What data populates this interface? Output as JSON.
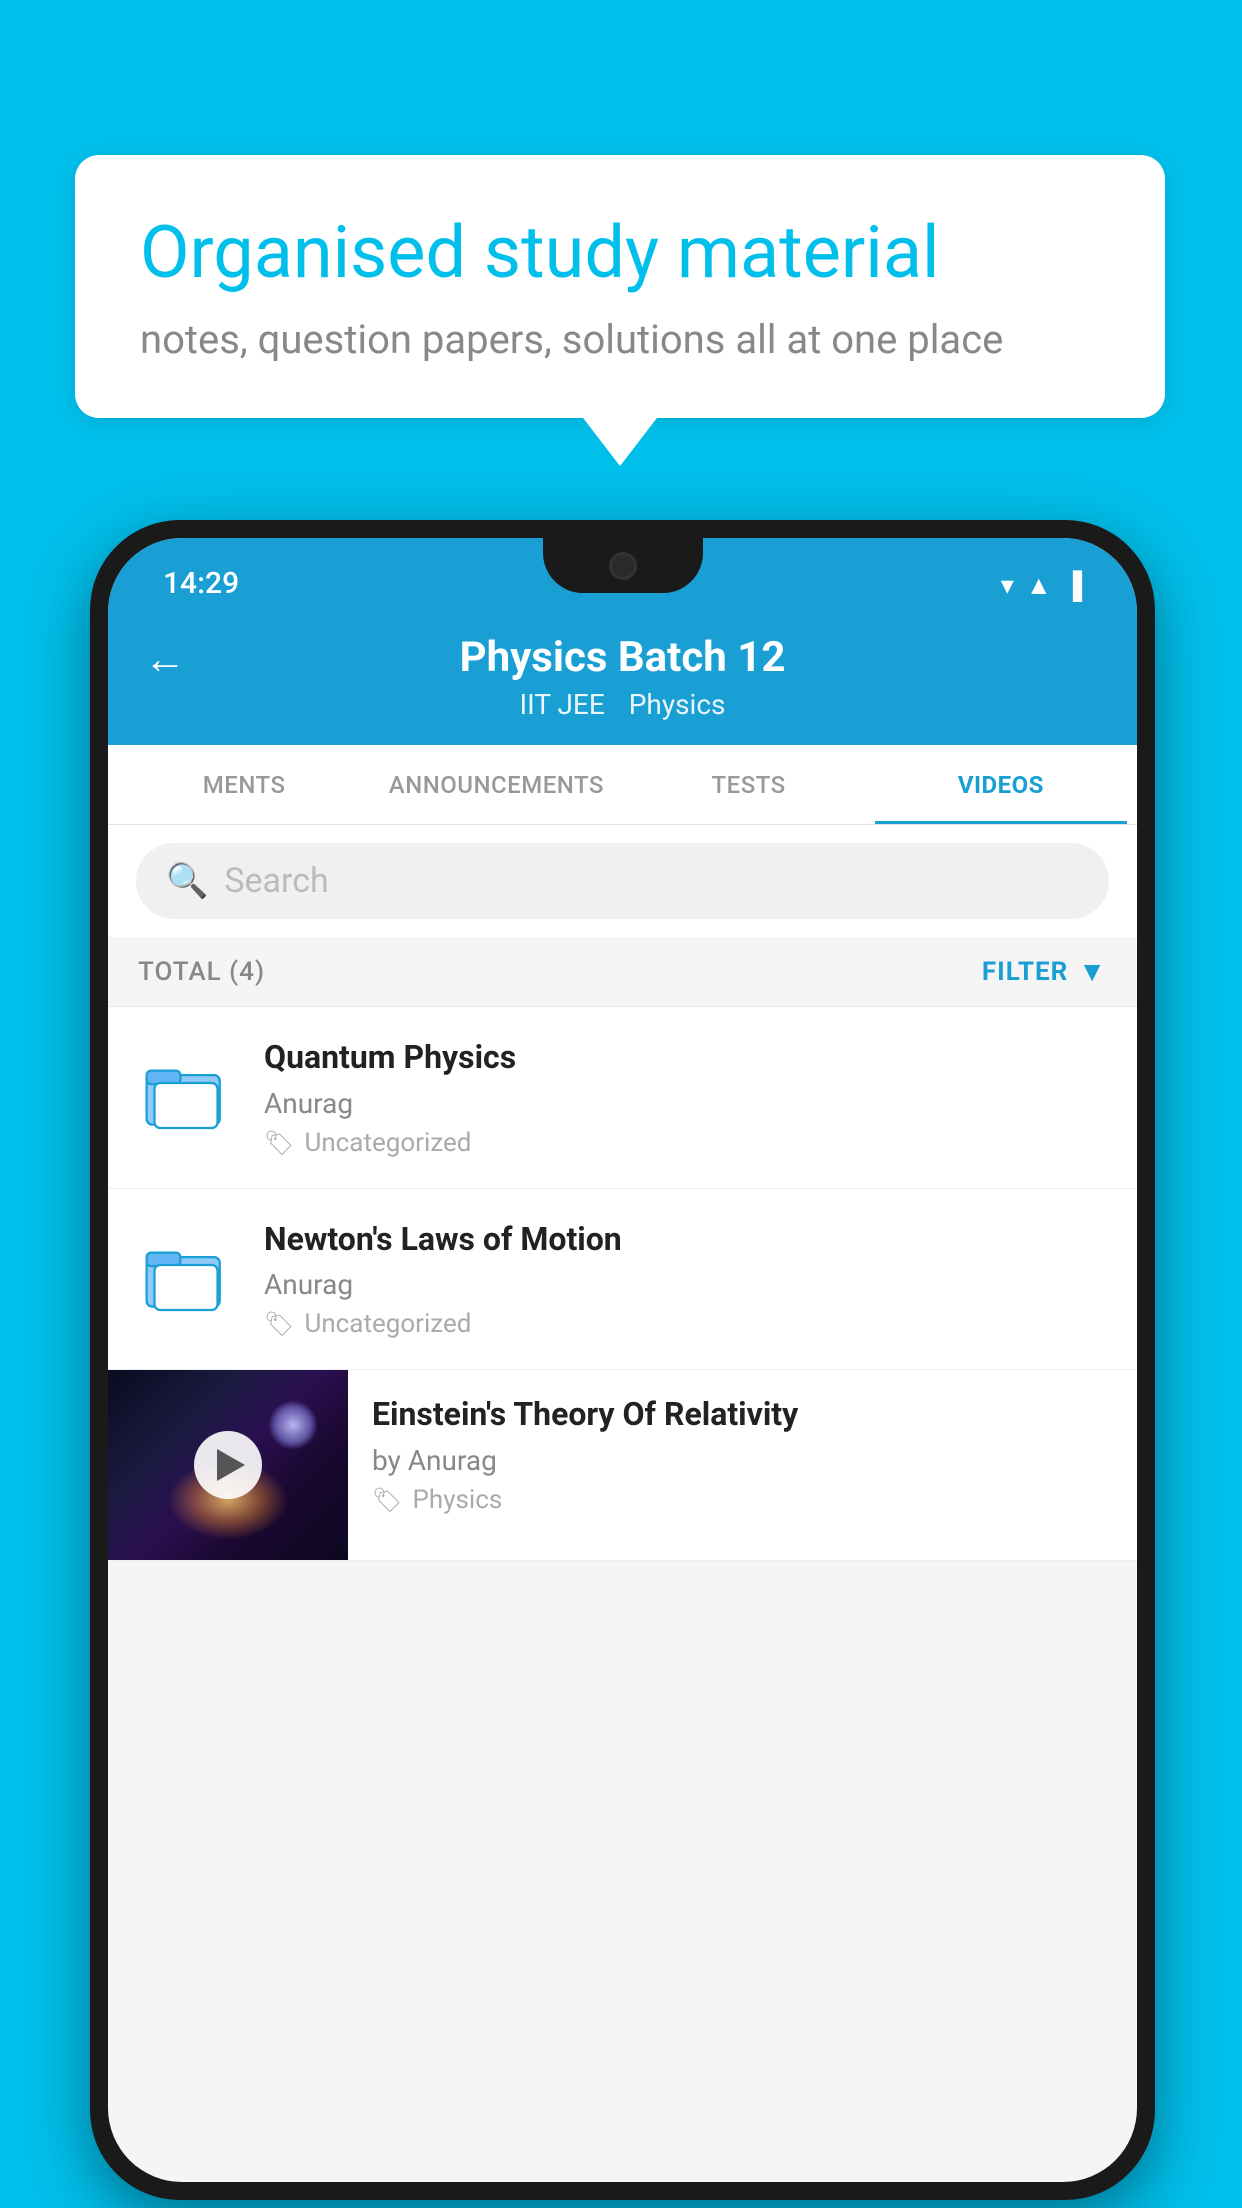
{
  "background": {
    "color": "#00BFEA"
  },
  "speech_bubble": {
    "title": "Organised study material",
    "subtitle": "notes, question papers, solutions all at one place"
  },
  "status_bar": {
    "time": "14:29",
    "icons": [
      "wifi",
      "signal",
      "battery"
    ]
  },
  "header": {
    "title": "Physics Batch 12",
    "tag1": "IIT JEE",
    "tag2": "Physics",
    "back_label": "←"
  },
  "tabs": [
    {
      "label": "MENTS",
      "active": false
    },
    {
      "label": "ANNOUNCEMENTS",
      "active": false
    },
    {
      "label": "TESTS",
      "active": false
    },
    {
      "label": "VIDEOS",
      "active": true
    }
  ],
  "search": {
    "placeholder": "Search"
  },
  "filter": {
    "total_label": "TOTAL (4)",
    "filter_label": "FILTER"
  },
  "videos": [
    {
      "title": "Quantum Physics",
      "author": "Anurag",
      "tag": "Uncategorized",
      "type": "folder"
    },
    {
      "title": "Newton's Laws of Motion",
      "author": "Anurag",
      "tag": "Uncategorized",
      "type": "folder"
    },
    {
      "title": "Einstein's Theory Of Relativity",
      "author": "by Anurag",
      "tag": "Physics",
      "type": "video"
    }
  ]
}
